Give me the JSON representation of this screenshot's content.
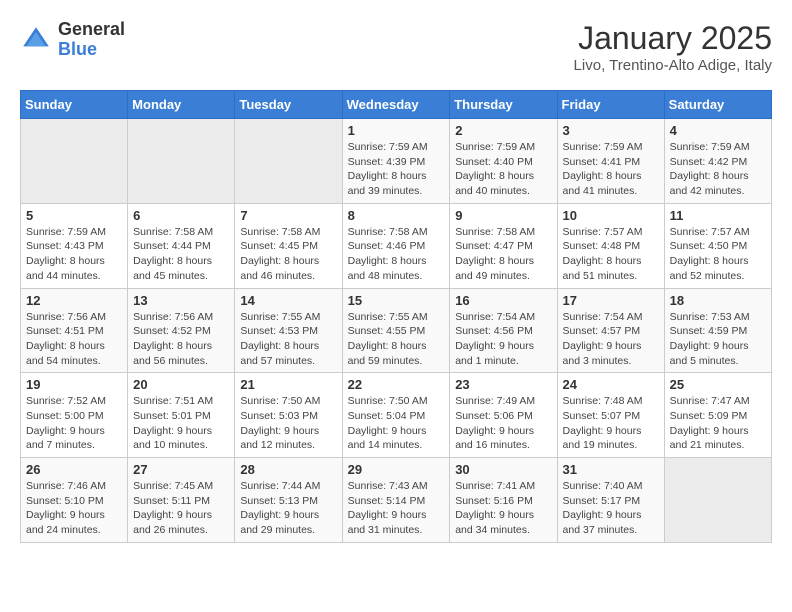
{
  "header": {
    "logo_general": "General",
    "logo_blue": "Blue",
    "month_title": "January 2025",
    "location": "Livo, Trentino-Alto Adige, Italy"
  },
  "weekdays": [
    "Sunday",
    "Monday",
    "Tuesday",
    "Wednesday",
    "Thursday",
    "Friday",
    "Saturday"
  ],
  "weeks": [
    [
      {
        "day": "",
        "info": ""
      },
      {
        "day": "",
        "info": ""
      },
      {
        "day": "",
        "info": ""
      },
      {
        "day": "1",
        "info": "Sunrise: 7:59 AM\nSunset: 4:39 PM\nDaylight: 8 hours and 39 minutes."
      },
      {
        "day": "2",
        "info": "Sunrise: 7:59 AM\nSunset: 4:40 PM\nDaylight: 8 hours and 40 minutes."
      },
      {
        "day": "3",
        "info": "Sunrise: 7:59 AM\nSunset: 4:41 PM\nDaylight: 8 hours and 41 minutes."
      },
      {
        "day": "4",
        "info": "Sunrise: 7:59 AM\nSunset: 4:42 PM\nDaylight: 8 hours and 42 minutes."
      }
    ],
    [
      {
        "day": "5",
        "info": "Sunrise: 7:59 AM\nSunset: 4:43 PM\nDaylight: 8 hours and 44 minutes."
      },
      {
        "day": "6",
        "info": "Sunrise: 7:58 AM\nSunset: 4:44 PM\nDaylight: 8 hours and 45 minutes."
      },
      {
        "day": "7",
        "info": "Sunrise: 7:58 AM\nSunset: 4:45 PM\nDaylight: 8 hours and 46 minutes."
      },
      {
        "day": "8",
        "info": "Sunrise: 7:58 AM\nSunset: 4:46 PM\nDaylight: 8 hours and 48 minutes."
      },
      {
        "day": "9",
        "info": "Sunrise: 7:58 AM\nSunset: 4:47 PM\nDaylight: 8 hours and 49 minutes."
      },
      {
        "day": "10",
        "info": "Sunrise: 7:57 AM\nSunset: 4:48 PM\nDaylight: 8 hours and 51 minutes."
      },
      {
        "day": "11",
        "info": "Sunrise: 7:57 AM\nSunset: 4:50 PM\nDaylight: 8 hours and 52 minutes."
      }
    ],
    [
      {
        "day": "12",
        "info": "Sunrise: 7:56 AM\nSunset: 4:51 PM\nDaylight: 8 hours and 54 minutes."
      },
      {
        "day": "13",
        "info": "Sunrise: 7:56 AM\nSunset: 4:52 PM\nDaylight: 8 hours and 56 minutes."
      },
      {
        "day": "14",
        "info": "Sunrise: 7:55 AM\nSunset: 4:53 PM\nDaylight: 8 hours and 57 minutes."
      },
      {
        "day": "15",
        "info": "Sunrise: 7:55 AM\nSunset: 4:55 PM\nDaylight: 8 hours and 59 minutes."
      },
      {
        "day": "16",
        "info": "Sunrise: 7:54 AM\nSunset: 4:56 PM\nDaylight: 9 hours and 1 minute."
      },
      {
        "day": "17",
        "info": "Sunrise: 7:54 AM\nSunset: 4:57 PM\nDaylight: 9 hours and 3 minutes."
      },
      {
        "day": "18",
        "info": "Sunrise: 7:53 AM\nSunset: 4:59 PM\nDaylight: 9 hours and 5 minutes."
      }
    ],
    [
      {
        "day": "19",
        "info": "Sunrise: 7:52 AM\nSunset: 5:00 PM\nDaylight: 9 hours and 7 minutes."
      },
      {
        "day": "20",
        "info": "Sunrise: 7:51 AM\nSunset: 5:01 PM\nDaylight: 9 hours and 10 minutes."
      },
      {
        "day": "21",
        "info": "Sunrise: 7:50 AM\nSunset: 5:03 PM\nDaylight: 9 hours and 12 minutes."
      },
      {
        "day": "22",
        "info": "Sunrise: 7:50 AM\nSunset: 5:04 PM\nDaylight: 9 hours and 14 minutes."
      },
      {
        "day": "23",
        "info": "Sunrise: 7:49 AM\nSunset: 5:06 PM\nDaylight: 9 hours and 16 minutes."
      },
      {
        "day": "24",
        "info": "Sunrise: 7:48 AM\nSunset: 5:07 PM\nDaylight: 9 hours and 19 minutes."
      },
      {
        "day": "25",
        "info": "Sunrise: 7:47 AM\nSunset: 5:09 PM\nDaylight: 9 hours and 21 minutes."
      }
    ],
    [
      {
        "day": "26",
        "info": "Sunrise: 7:46 AM\nSunset: 5:10 PM\nDaylight: 9 hours and 24 minutes."
      },
      {
        "day": "27",
        "info": "Sunrise: 7:45 AM\nSunset: 5:11 PM\nDaylight: 9 hours and 26 minutes."
      },
      {
        "day": "28",
        "info": "Sunrise: 7:44 AM\nSunset: 5:13 PM\nDaylight: 9 hours and 29 minutes."
      },
      {
        "day": "29",
        "info": "Sunrise: 7:43 AM\nSunset: 5:14 PM\nDaylight: 9 hours and 31 minutes."
      },
      {
        "day": "30",
        "info": "Sunrise: 7:41 AM\nSunset: 5:16 PM\nDaylight: 9 hours and 34 minutes."
      },
      {
        "day": "31",
        "info": "Sunrise: 7:40 AM\nSunset: 5:17 PM\nDaylight: 9 hours and 37 minutes."
      },
      {
        "day": "",
        "info": ""
      }
    ]
  ]
}
